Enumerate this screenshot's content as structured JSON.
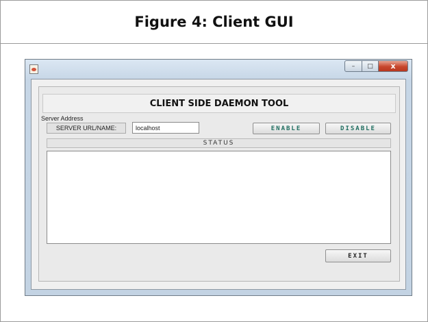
{
  "figure": {
    "caption": "Figure 4: Client GUI"
  },
  "window": {
    "title": "",
    "icons": {
      "app": "java-app-icon",
      "minimize": "minimize-icon",
      "maximize": "maximize-icon",
      "close": "close-icon"
    },
    "buttons": {
      "min_glyph": "–",
      "max_glyph": "□",
      "close_glyph": "x"
    }
  },
  "tool": {
    "title": "CLIENT SIDE DAEMON TOOL",
    "section_label": "Server Address",
    "url_label": "SERVER URL/NAME:",
    "url_value": "localhost",
    "enable_label": "ENABLE",
    "disable_label": "DISABLE",
    "status_label": "STATUS",
    "status_text": "",
    "exit_label": "EXIT"
  },
  "colors": {
    "button_text_accent": "#1f6e60",
    "close_button": "#c7462d"
  }
}
